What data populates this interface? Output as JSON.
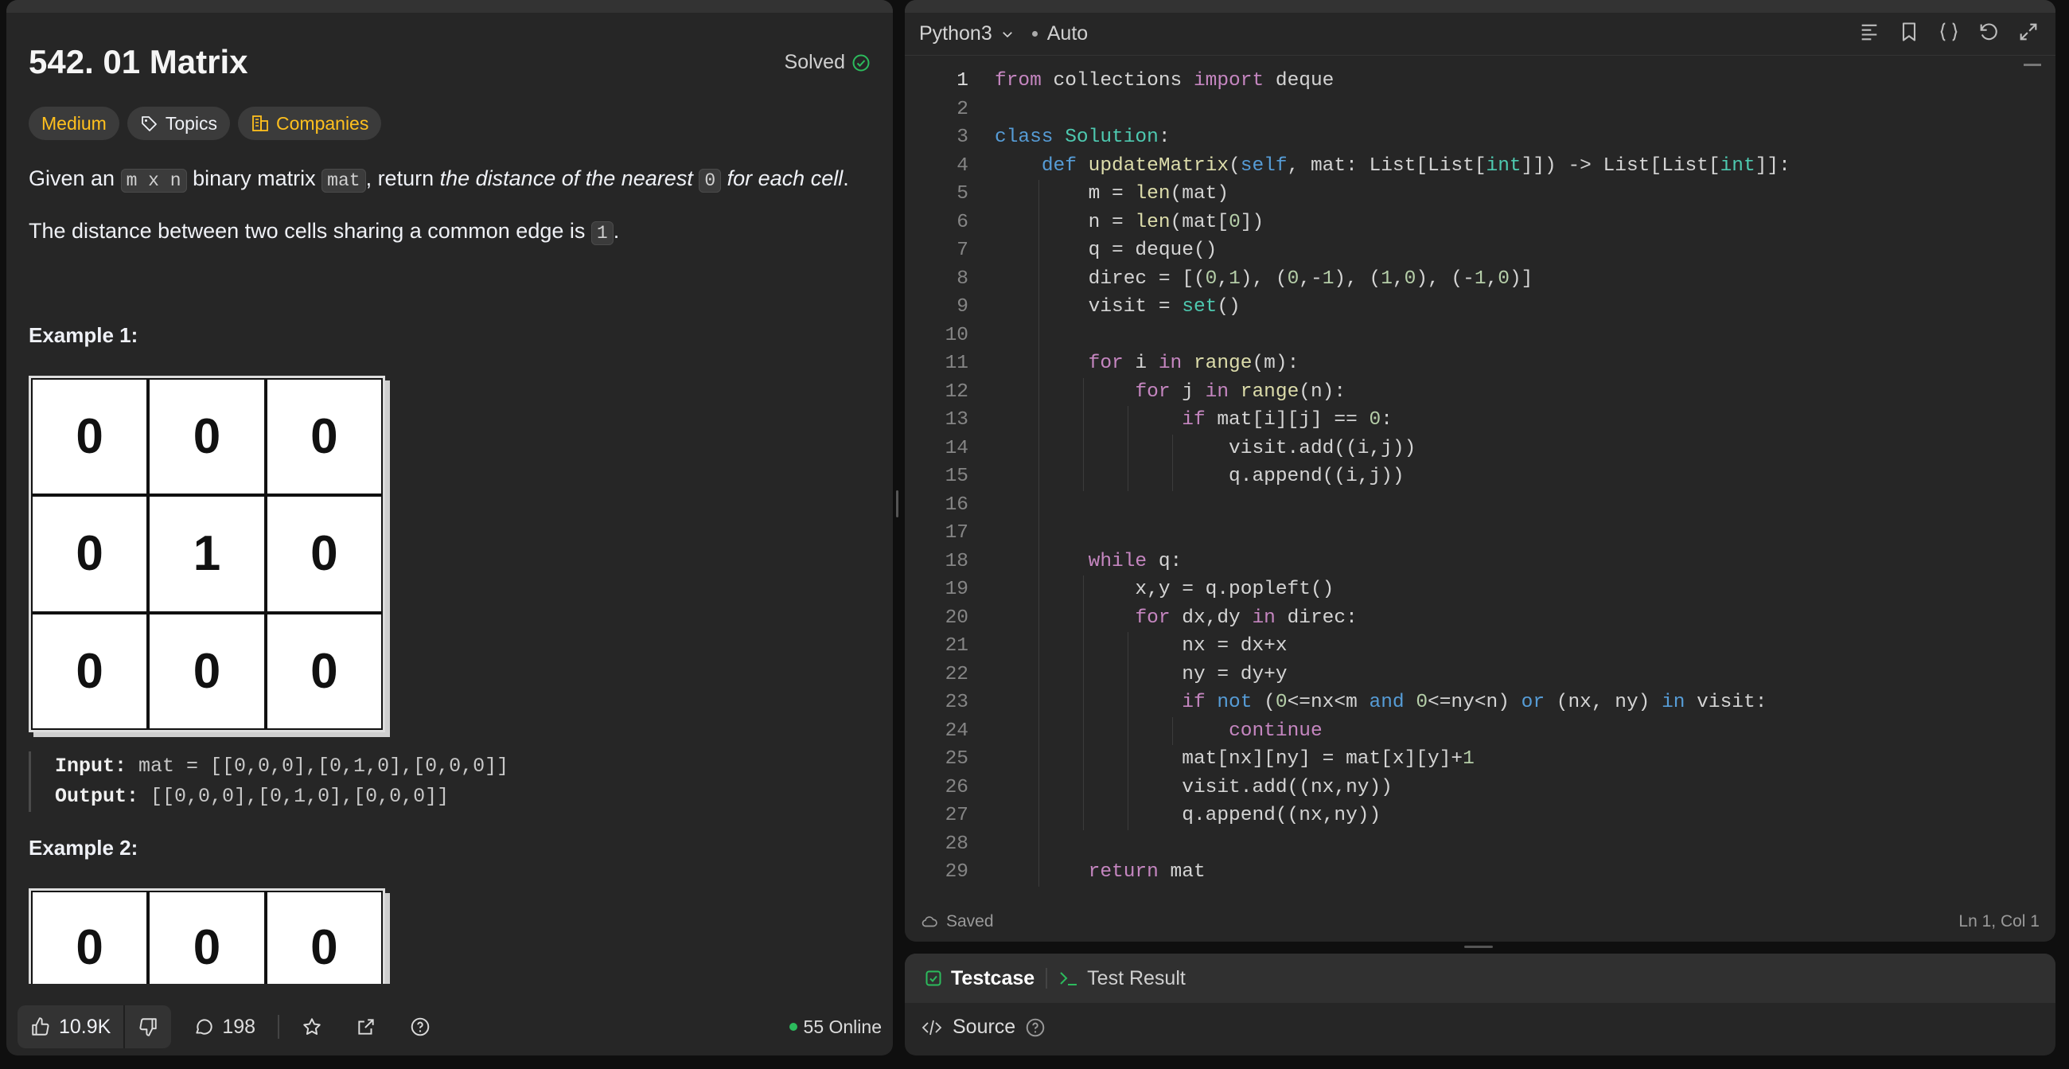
{
  "problem": {
    "title": "542. 01 Matrix",
    "status": "Solved",
    "tags": {
      "difficulty": "Medium",
      "topics": "Topics",
      "companies": "Companies"
    },
    "desc1": {
      "a": "Given an ",
      "c1": "m x n",
      "b": " binary matrix ",
      "c2": "mat",
      "c": ", return ",
      "i": "the distance of the nearest ",
      "c3": "0",
      "d": " for each cell",
      "e": "."
    },
    "desc2": {
      "a": "The distance between two cells sharing a common edge is ",
      "c1": "1",
      "b": "."
    },
    "example1": {
      "title": "Example 1:",
      "grid": [
        "0",
        "0",
        "0",
        "0",
        "1",
        "0",
        "0",
        "0",
        "0"
      ],
      "input_label": "Input:",
      "input": " mat = [[0,0,0],[0,1,0],[0,0,0]]",
      "output_label": "Output:",
      "output": " [[0,0,0],[0,1,0],[0,0,0]]"
    },
    "example2": {
      "title": "Example 2:",
      "grid": [
        "0",
        "0",
        "0"
      ]
    }
  },
  "footer": {
    "likes": "10.9K",
    "comments": "198",
    "online": "55 Online"
  },
  "editor": {
    "language": "Python3",
    "mode": "Auto",
    "status": "Saved",
    "cursor": "Ln 1, Col 1"
  },
  "bottom": {
    "tab1": "Testcase",
    "tab2": "Test Result",
    "source": "Source"
  },
  "colors": {
    "accent_green": "#2cbb5d",
    "difficulty_medium": "#ffc01e"
  }
}
